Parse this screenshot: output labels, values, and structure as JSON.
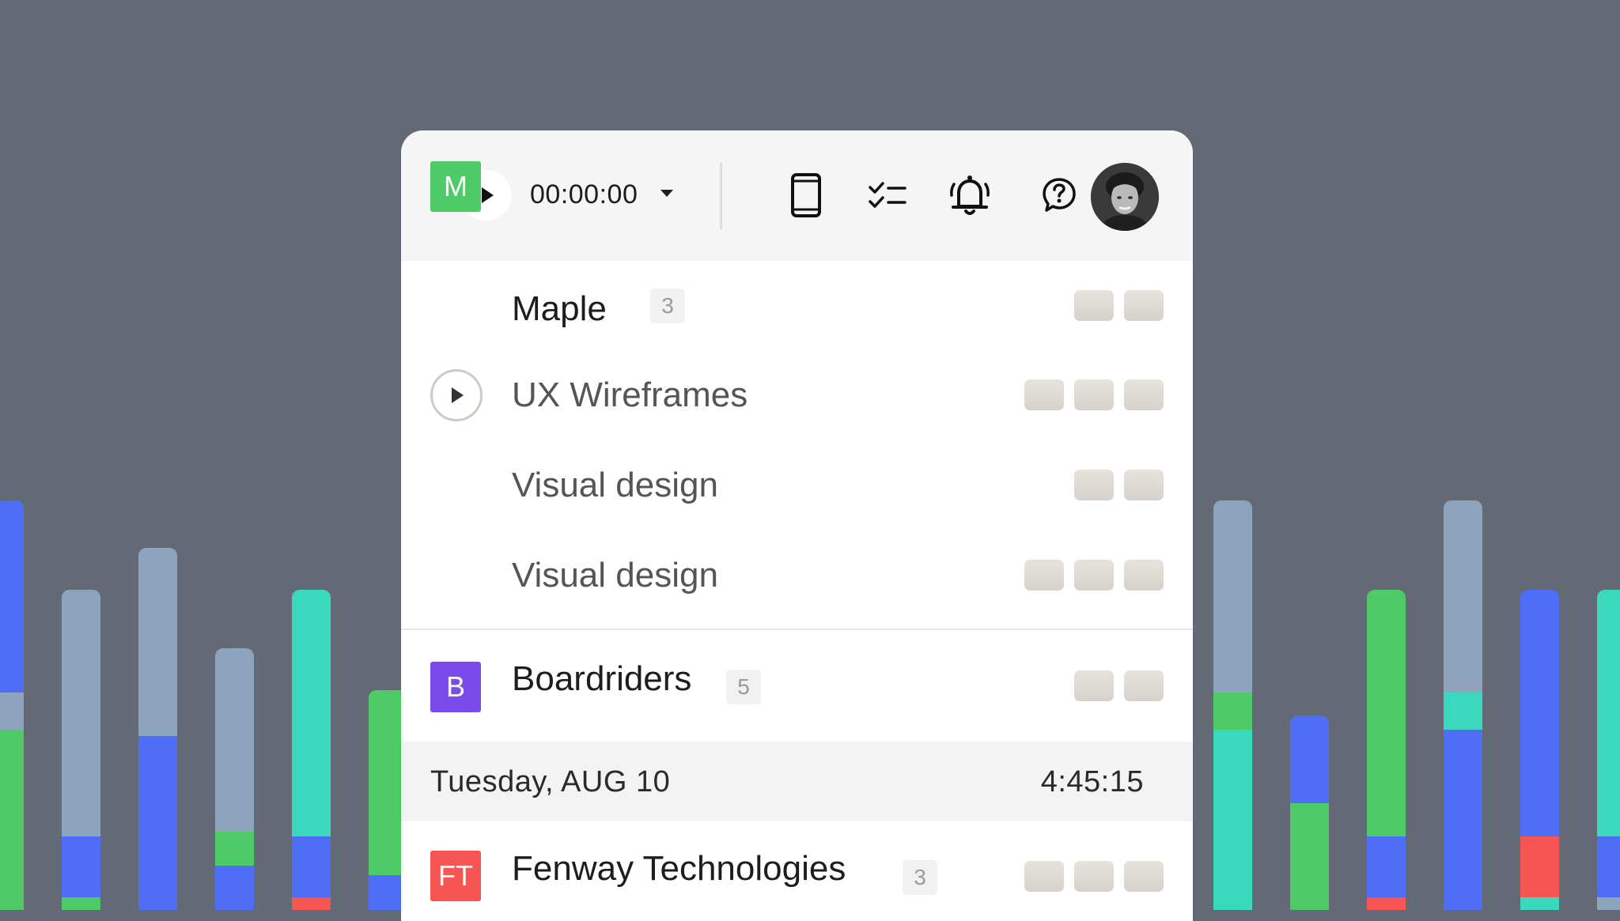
{
  "colors": {
    "background": "#636975",
    "bar_slate": "#8ea3bc",
    "bar_blue": "#4f6ef7",
    "bar_green": "#4ecb66",
    "bar_teal": "#3ad8bd",
    "bar_red": "#f55654",
    "badge_maple": "#4ecb66",
    "badge_boardriders": "#7a4bea",
    "badge_fenway": "#f55654"
  },
  "decor_bars": [
    {
      "segments": [
        {
          "color": "#4f6ef7",
          "frac": 0.47
        },
        {
          "color": "#8ea3bc",
          "frac": 0.09
        },
        {
          "color": "#4ecb66",
          "frac": 0.44
        }
      ]
    },
    {
      "segments": [
        {
          "color": "#8ea3bc",
          "frac": 0.77
        },
        {
          "color": "#4f6ef7",
          "frac": 0.19
        },
        {
          "color": "#4ecb66",
          "frac": 0.04
        }
      ]
    },
    {
      "segments": [
        {
          "color": "#8ea3bc",
          "frac": 0.52
        },
        {
          "color": "#4f6ef7",
          "frac": 0.48
        }
      ]
    },
    {
      "segments": [
        {
          "color": "#8ea3bc",
          "frac": 0.7
        },
        {
          "color": "#4ecb66",
          "frac": 0.13
        },
        {
          "color": "#4f6ef7",
          "frac": 0.17
        }
      ]
    },
    {
      "segments": [
        {
          "color": "#3ad8bd",
          "frac": 0.77
        },
        {
          "color": "#4f6ef7",
          "frac": 0.19
        },
        {
          "color": "#f55654",
          "frac": 0.04
        }
      ]
    },
    {
      "segments": [
        {
          "color": "#4ecb66",
          "frac": 0.84
        },
        {
          "color": "#4f6ef7",
          "frac": 0.16
        }
      ]
    },
    {
      "segments": [
        {
          "color": "#8ea3bc",
          "frac": 0.47
        },
        {
          "color": "#4ecb66",
          "frac": 0.09
        },
        {
          "color": "#3ad8bd",
          "frac": 0.44
        }
      ]
    },
    {
      "segments": [
        {
          "color": "#4f6ef7",
          "frac": 0.45
        },
        {
          "color": "#4ecb66",
          "frac": 0.55
        }
      ]
    },
    {
      "segments": [
        {
          "color": "#4ecb66",
          "frac": 0.77
        },
        {
          "color": "#4f6ef7",
          "frac": 0.19
        },
        {
          "color": "#f55654",
          "frac": 0.04
        }
      ]
    },
    {
      "segments": [
        {
          "color": "#8ea3bc",
          "frac": 0.47
        },
        {
          "color": "#3ad8bd",
          "frac": 0.09
        },
        {
          "color": "#4f6ef7",
          "frac": 0.44
        }
      ]
    },
    {
      "segments": [
        {
          "color": "#4f6ef7",
          "frac": 0.77
        },
        {
          "color": "#f55654",
          "frac": 0.19
        },
        {
          "color": "#3ad8bd",
          "frac": 0.04
        }
      ]
    },
    {
      "segments": [
        {
          "color": "#3ad8bd",
          "frac": 0.77
        },
        {
          "color": "#4f6ef7",
          "frac": 0.19
        },
        {
          "color": "#8ea3bc",
          "frac": 0.04
        }
      ]
    }
  ],
  "toolbar": {
    "timer": "00:00:00",
    "icons": {
      "play": "play-icon",
      "dropdown": "caret-down-icon",
      "mobile": "mobile-device-icon",
      "tasks": "checklist-icon",
      "notifications": "bell-icon",
      "help": "help-question-icon",
      "avatar": "user-avatar"
    }
  },
  "clients": [
    {
      "badge": "M",
      "name": "Maple",
      "count": "3",
      "projects": [
        {
          "name": "UX Wireframes"
        },
        {
          "name": "Visual design"
        },
        {
          "name": "Visual design"
        }
      ]
    },
    {
      "badge": "B",
      "name": "Boardriders",
      "count": "5"
    }
  ],
  "day": {
    "label": "Tuesday, AUG 10",
    "total": "4:45:15"
  },
  "clients_after": [
    {
      "badge": "FT",
      "name": "Fenway Technologies",
      "count": "3"
    }
  ]
}
